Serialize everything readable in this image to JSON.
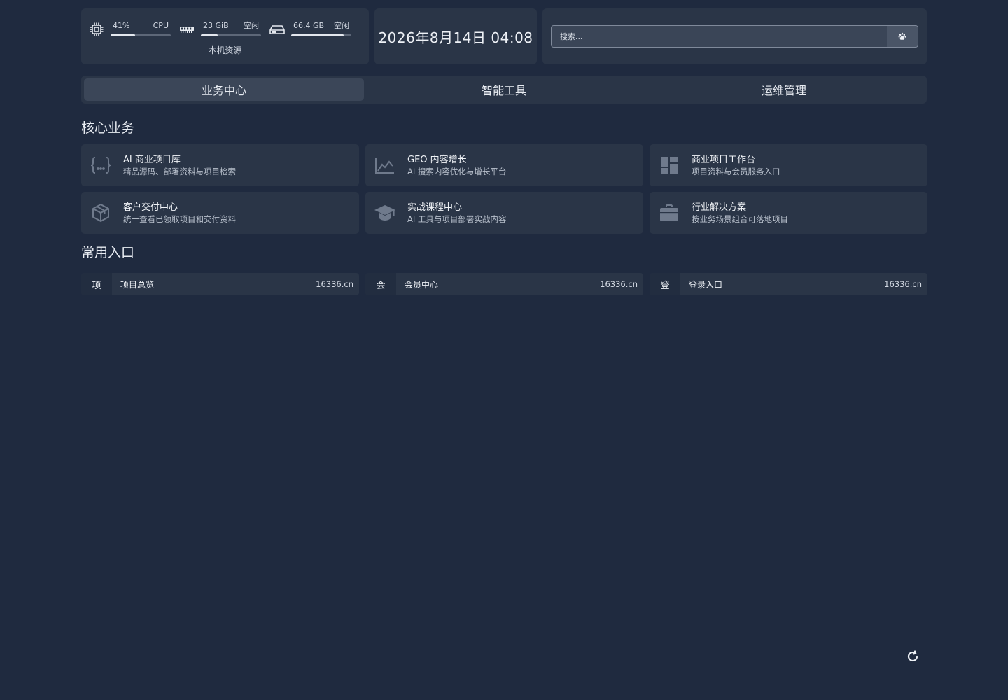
{
  "resources": {
    "cpu": {
      "percent_label": "41%",
      "name": "CPU",
      "fraction": 0.41,
      "icon": "cpu-icon"
    },
    "memory": {
      "value": "23 GiB",
      "status": "空闲",
      "fraction": 0.28,
      "icon": "memory-icon"
    },
    "disk": {
      "value": "66.4 GB",
      "status": "空闲",
      "fraction": 0.87,
      "icon": "disk-icon"
    },
    "caption": "本机资源"
  },
  "datetime": "2026年8月14日 04:08",
  "search": {
    "placeholder": "搜索...",
    "engine_icon": "baidu-paw-icon"
  },
  "tabs": [
    {
      "label": "业务中心",
      "active": true
    },
    {
      "label": "智能工具",
      "active": false
    },
    {
      "label": "运维管理",
      "active": false
    }
  ],
  "core": {
    "title": "核心业务",
    "items": [
      {
        "title": "AI 商业项目库",
        "desc": "精品源码、部署资料与项目检索",
        "icon": "code-braces-icon"
      },
      {
        "title": "GEO 内容增长",
        "desc": "AI 搜索内容优化与增长平台",
        "icon": "line-chart-icon"
      },
      {
        "title": "商业项目工作台",
        "desc": "项目资料与会员服务入口",
        "icon": "dashboard-icon"
      },
      {
        "title": "客户交付中心",
        "desc": "统一查看已领取项目和交付资料",
        "icon": "package-box-icon"
      },
      {
        "title": "实战课程中心",
        "desc": "AI 工具与项目部署实战内容",
        "icon": "graduation-cap-icon"
      },
      {
        "title": "行业解决方案",
        "desc": "按业务场景组合可落地项目",
        "icon": "briefcase-icon"
      }
    ]
  },
  "entries": {
    "title": "常用入口",
    "items": [
      {
        "badge": "项",
        "label": "项目总览",
        "url": "16336.cn"
      },
      {
        "badge": "会",
        "label": "会员中心",
        "url": "16336.cn"
      },
      {
        "badge": "登",
        "label": "登录入口",
        "url": "16336.cn"
      }
    ]
  },
  "colors": {
    "background": "#1f2a3f",
    "card": "#2a3547",
    "accent_text": "#e8ecf2"
  }
}
